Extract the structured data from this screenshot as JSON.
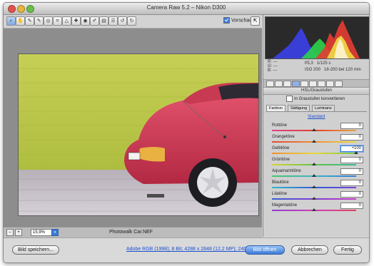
{
  "window": {
    "title": "Camera Raw 5.2 – Nikon D300"
  },
  "toolbar": {
    "tools": [
      "zoom-icon",
      "hand-icon",
      "white-balance-icon",
      "color-sampler-icon",
      "target-adjust-icon",
      "crop-icon",
      "straighten-icon",
      "spot-removal-icon",
      "red-eye-icon",
      "adjustment-brush-icon",
      "graduated-filter-icon",
      "preferences-icon",
      "rotate-left-icon",
      "rotate-right-icon"
    ],
    "preview_label": "Vorschau",
    "preview_checked": true
  },
  "status": {
    "zoom": "15,9%",
    "filename": "Photowalk Car.NEF"
  },
  "info": {
    "r": "R:",
    "g": "G:",
    "b": "B:",
    "r_val": "---",
    "g_val": "---",
    "b_val": "---",
    "aperture": "f/5,3",
    "shutter": "1/125 s",
    "iso": "ISO 200",
    "lens": "18-200 bei 120 mm"
  },
  "panel": {
    "title": "HSL/Graustufen",
    "grayscale_label": "In Graustufen konvertieren",
    "subtabs": [
      "Farbton",
      "Sättigung",
      "Luminanz"
    ],
    "standard_link": "Standard",
    "sliders": [
      {
        "label": "Rottöne",
        "value": "0",
        "fraction": 0.5,
        "gradient": "linear-gradient(90deg,#d7458b,#e33d2d,#e8a53a)"
      },
      {
        "label": "Orangetöne",
        "value": "0",
        "fraction": 0.5,
        "gradient": "linear-gradient(90deg,#e14a37,#ef8f34,#e7d83d)"
      },
      {
        "label": "Gelbtöne",
        "value": "+100",
        "fraction": 1.0,
        "active": true,
        "gradient": "linear-gradient(90deg,#ef8f34,#e7d83d,#75c848)"
      },
      {
        "label": "Grüntöne",
        "value": "0",
        "fraction": 0.5,
        "gradient": "linear-gradient(90deg,#dad33a,#5fc342,#37b797)"
      },
      {
        "label": "Aquamarintöne",
        "value": "0",
        "fraction": 0.5,
        "gradient": "linear-gradient(90deg,#4ec36c,#3bb5c8,#3a7ad6)"
      },
      {
        "label": "Blautöne",
        "value": "0",
        "fraction": 0.5,
        "gradient": "linear-gradient(90deg,#36b8c8,#2c5ed9,#7b3ed2)"
      },
      {
        "label": "Lilatöne",
        "value": "0",
        "fraction": 0.5,
        "gradient": "linear-gradient(90deg,#3a5fd5,#7a3cd0,#c73cc2)"
      },
      {
        "label": "Magentatöne",
        "value": "0",
        "fraction": 0.5,
        "gradient": "linear-gradient(90deg,#8e3ed0,#cc3fb7,#e0405b)"
      }
    ]
  },
  "footer": {
    "save_label": "Bild speichern...",
    "workflow_link": "Adobe RGB (1998); 8 Bit; 4288 x 2848 (12,2 MP); 240 ppi",
    "open_label": "Bild öffnen",
    "cancel_label": "Abbrechen",
    "done_label": "Fertig"
  }
}
